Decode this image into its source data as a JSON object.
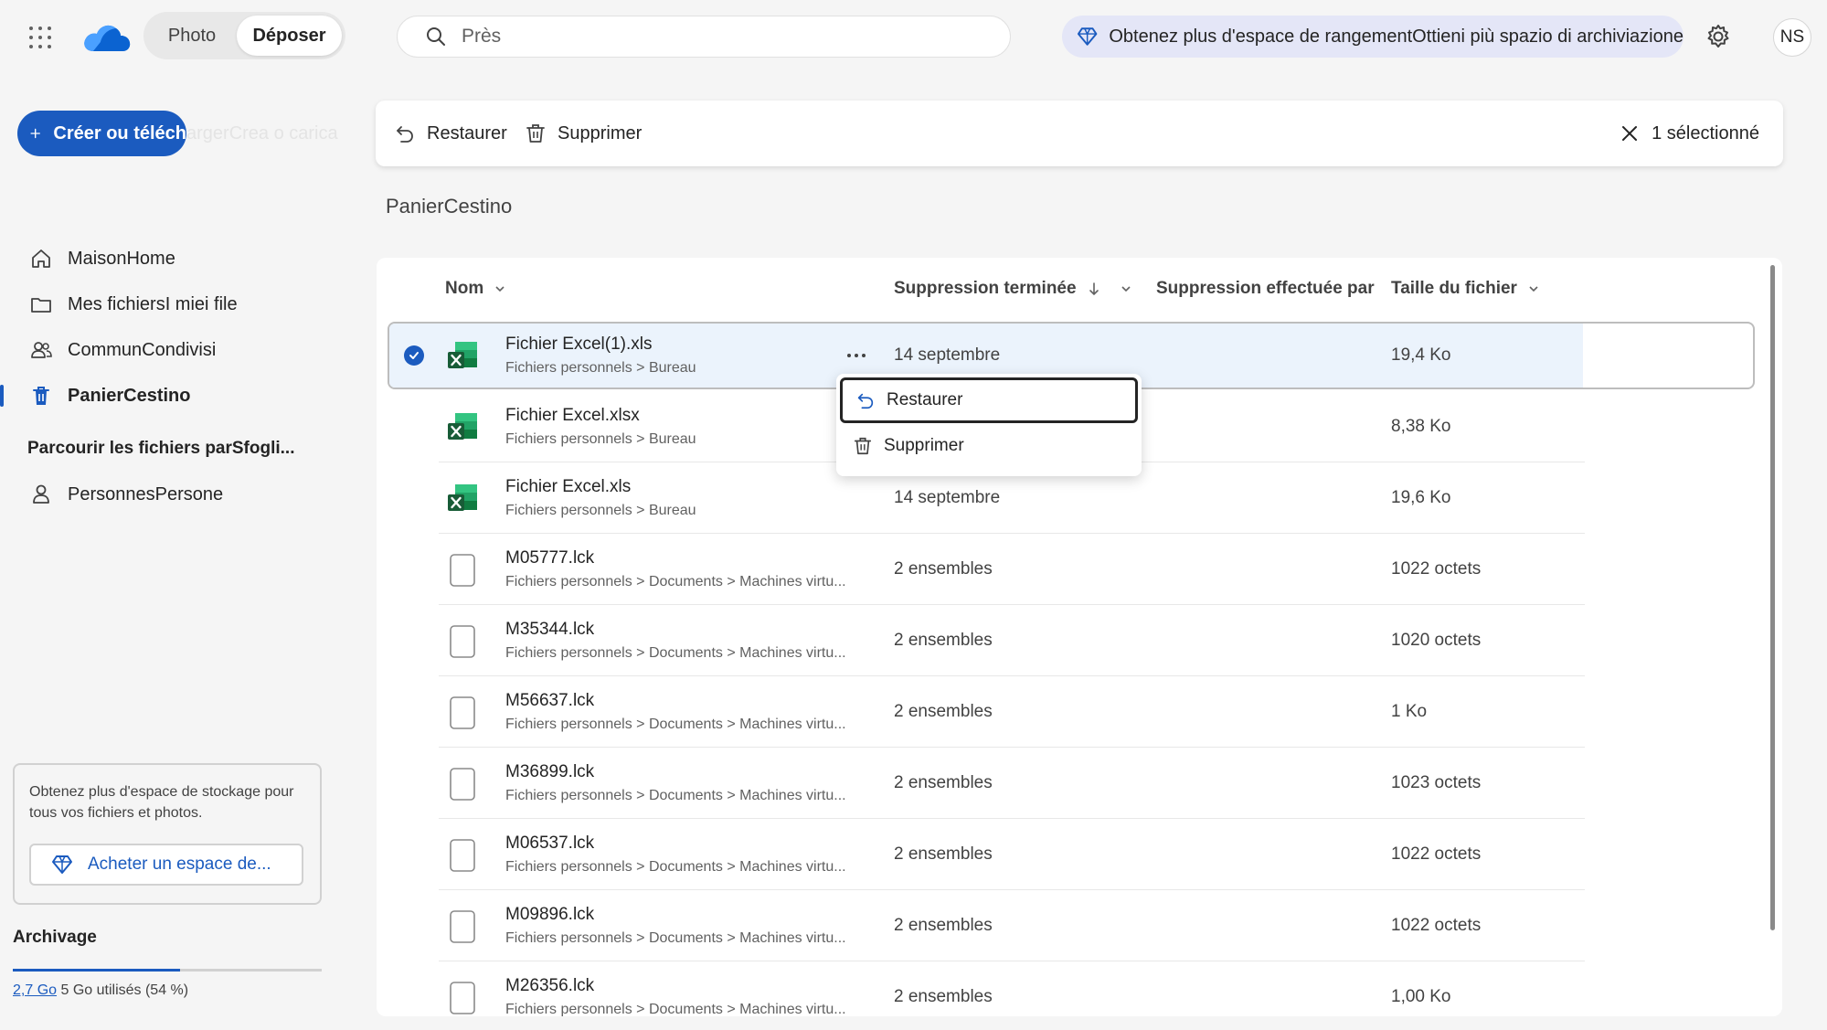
{
  "header": {
    "switch": {
      "photo": "Photo",
      "files": "Déposer"
    },
    "search_placeholder": "Près",
    "promo": "Obtenez plus d'espace de rangementOttieni più spazio di archiviazione",
    "avatar": "NS"
  },
  "sidebar": {
    "create_label": "Créer ou téléch",
    "create_ghost": "argerCrea o carica",
    "items": [
      {
        "label": "MaisonHome",
        "icon": "home-icon"
      },
      {
        "label": "Mes fichiersI miei file",
        "icon": "folder-icon"
      },
      {
        "label": "CommunCondivisi",
        "icon": "people-icon"
      },
      {
        "label": "PanierCestino",
        "icon": "trash-icon",
        "active": true
      }
    ],
    "browse_title": "Parcourir les fichiers parSfogli...",
    "people_label": "PersonnesPersone",
    "storage_text": "Obtenez plus d'espace de stockage pour tous vos fichiers et photos.",
    "buy_label": "Acheter un espace de...",
    "archive_title": "Archivage",
    "usage_link": "2,7 Go",
    "usage_rest": " 5 Go utilisés (54 %)",
    "usage_fraction": 0.54
  },
  "commandbar": {
    "restore": "Restaurer",
    "delete": "Supprimer",
    "selected": "1 sélectionné"
  },
  "page_title": "PanierCestino",
  "table": {
    "columns": {
      "name": "Nom",
      "deleted": "Suppression terminée",
      "deleted_by": "Suppression effectuée par",
      "size": "Taille du fichier"
    },
    "rows": [
      {
        "name": "Fichier Excel(1).xls",
        "path": "Fichiers personnels > Bureau",
        "deleted": "14 septembre",
        "size": "19,4 Ko",
        "type": "excel",
        "selected": true
      },
      {
        "name": "Fichier Excel.xlsx",
        "path": "Fichiers personnels > Bureau",
        "deleted": "",
        "size": "8,38 Ko",
        "type": "excel"
      },
      {
        "name": "Fichier Excel.xls",
        "path": "Fichiers personnels > Bureau",
        "deleted": "14 septembre",
        "size": "19,6 Ko",
        "type": "excel"
      },
      {
        "name": "M05777.lck",
        "path": "Fichiers personnels > Documents > Machines virtu...",
        "deleted": "2 ensembles",
        "size": "1022 octets",
        "type": "generic"
      },
      {
        "name": "M35344.lck",
        "path": "Fichiers personnels > Documents > Machines virtu...",
        "deleted": "2 ensembles",
        "size": "1020 octets",
        "type": "generic"
      },
      {
        "name": "M56637.lck",
        "path": "Fichiers personnels > Documents > Machines virtu...",
        "deleted": "2 ensembles",
        "size": "1 Ko",
        "type": "generic"
      },
      {
        "name": "M36899.lck",
        "path": "Fichiers personnels > Documents > Machines virtu...",
        "deleted": "2 ensembles",
        "size": "1023 octets",
        "type": "generic"
      },
      {
        "name": "M06537.lck",
        "path": "Fichiers personnels > Documents > Machines virtu...",
        "deleted": "2 ensembles",
        "size": "1022 octets",
        "type": "generic"
      },
      {
        "name": "M09896.lck",
        "path": "Fichiers personnels > Documents > Machines virtu...",
        "deleted": "2 ensembles",
        "size": "1022 octets",
        "type": "generic"
      },
      {
        "name": "M26356.lck",
        "path": "Fichiers personnels > Documents > Machines virtu...",
        "deleted": "2 ensembles",
        "size": "1,00 Ko",
        "type": "generic"
      }
    ]
  },
  "context_menu": {
    "restore": "Restaurer",
    "delete": "Supprimer"
  },
  "colors": {
    "accent": "#1b5bbf",
    "selected_row": "#ebf3fc",
    "promo_bg": "#e4e6f7"
  }
}
